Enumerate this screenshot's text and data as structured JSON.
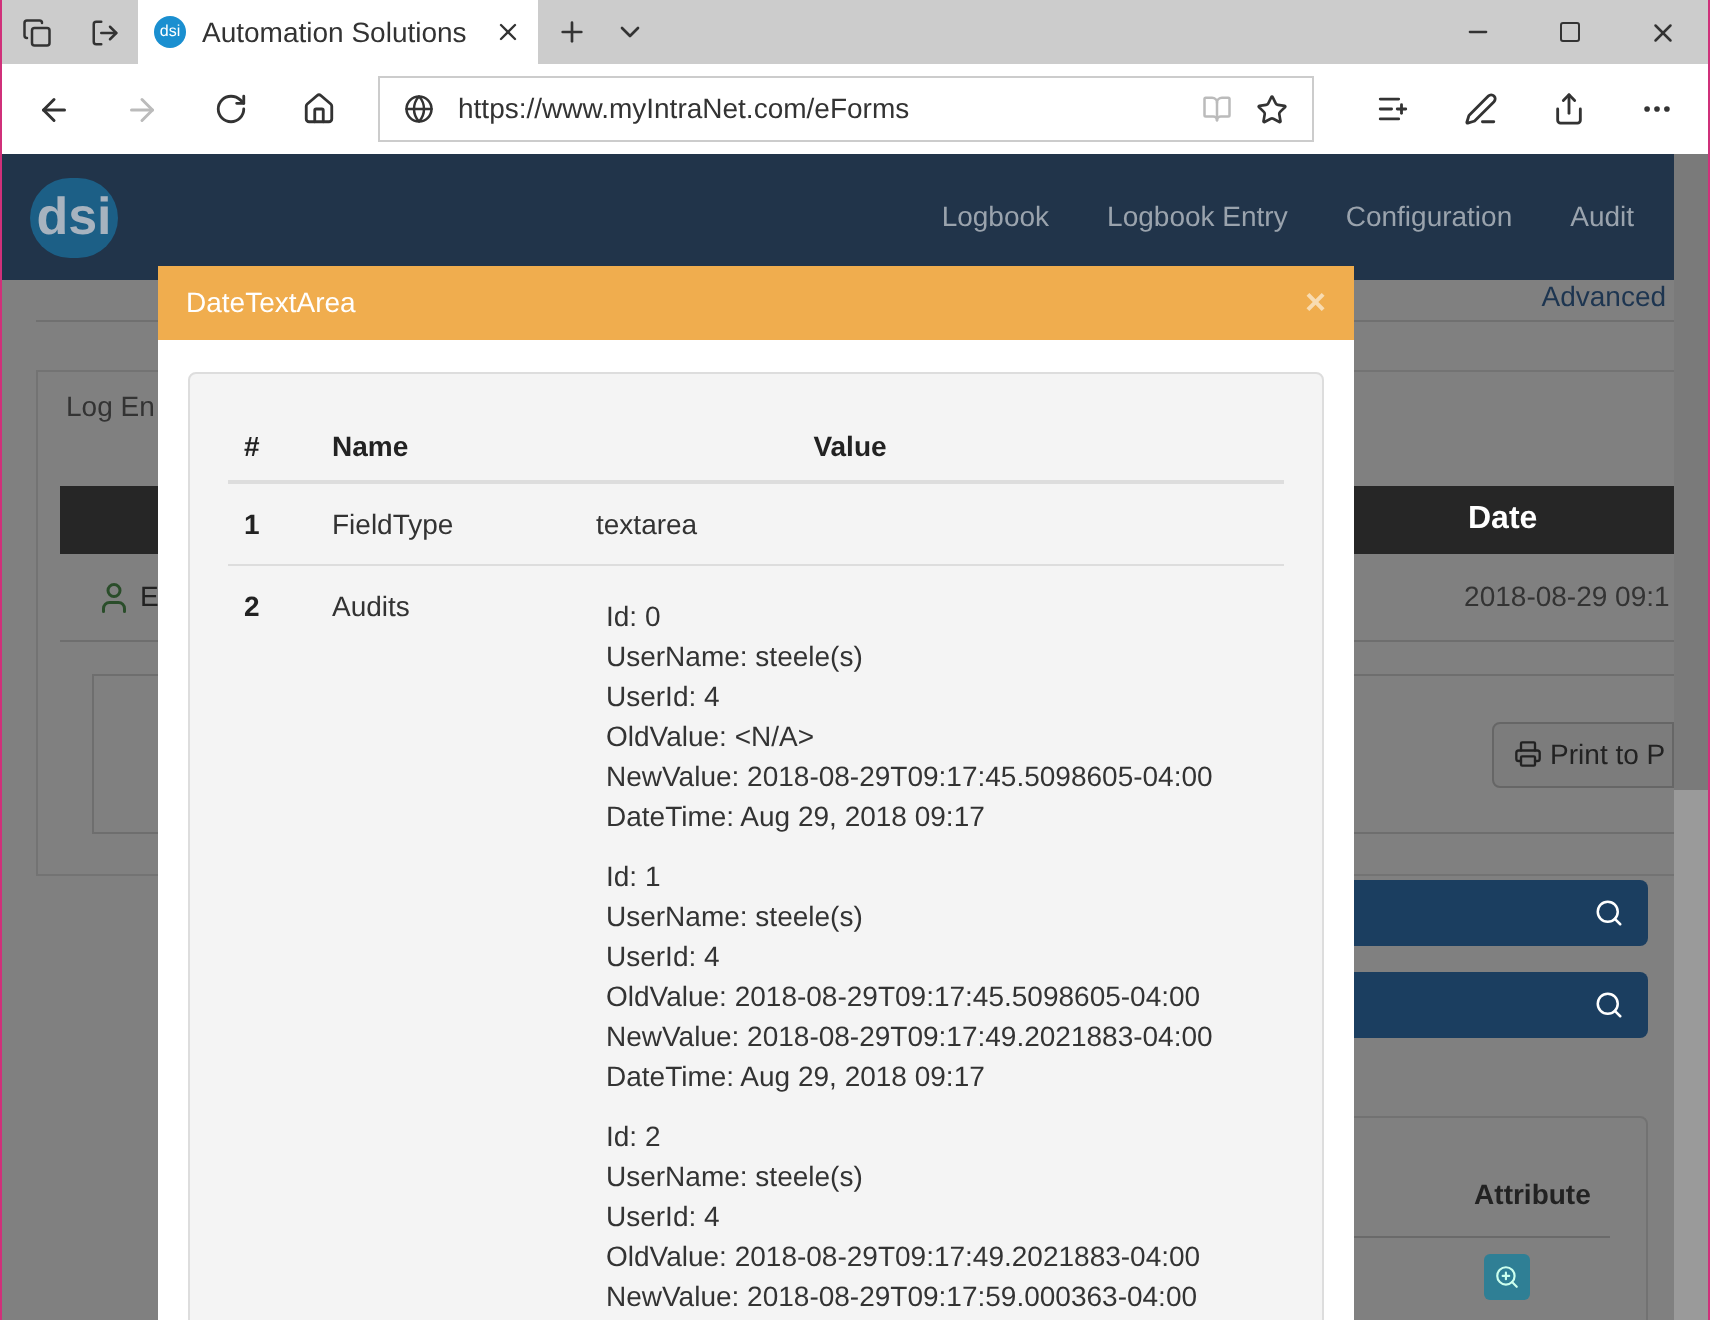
{
  "browser": {
    "favicon": "dsi",
    "tab_title": "Automation Solutions",
    "url": "https://www.myIntraNet.com/eForms"
  },
  "navbar": {
    "logo": "dsi",
    "items": [
      "Logbook",
      "Logbook Entry",
      "Configuration",
      "Audit"
    ]
  },
  "page": {
    "advanced_link": "Advanced",
    "tab": "Log En",
    "table_header": "Date",
    "row": {
      "column_1": "E",
      "date": "2018-08-29 09:1"
    },
    "print_button": "Print to P",
    "panel_header": "Attribute"
  },
  "modal": {
    "title": "DateTextArea",
    "close": "×",
    "columns": [
      "#",
      "Name",
      "Value"
    ],
    "rows": [
      {
        "kind": "text",
        "number": "1",
        "name": "FieldType",
        "value": "textarea"
      },
      {
        "kind": "audits",
        "number": "2",
        "name": "Audits",
        "audits": [
          [
            "Id: 0",
            "UserName: steele(s)",
            "UserId: 4",
            "OldValue: <N/A>",
            "NewValue: 2018-08-29T09:17:45.5098605-04:00",
            "DateTime: Aug 29, 2018 09:17"
          ],
          [
            "Id: 1",
            "UserName: steele(s)",
            "UserId: 4",
            "OldValue: 2018-08-29T09:17:45.5098605-04:00",
            "NewValue: 2018-08-29T09:17:49.2021883-04:00",
            "DateTime: Aug 29, 2018 09:17"
          ],
          [
            "Id: 2",
            "UserName: steele(s)",
            "UserId: 4",
            "OldValue: 2018-08-29T09:17:49.2021883-04:00",
            "NewValue: 2018-08-29T09:17:59.000363-04:00"
          ]
        ]
      }
    ]
  }
}
